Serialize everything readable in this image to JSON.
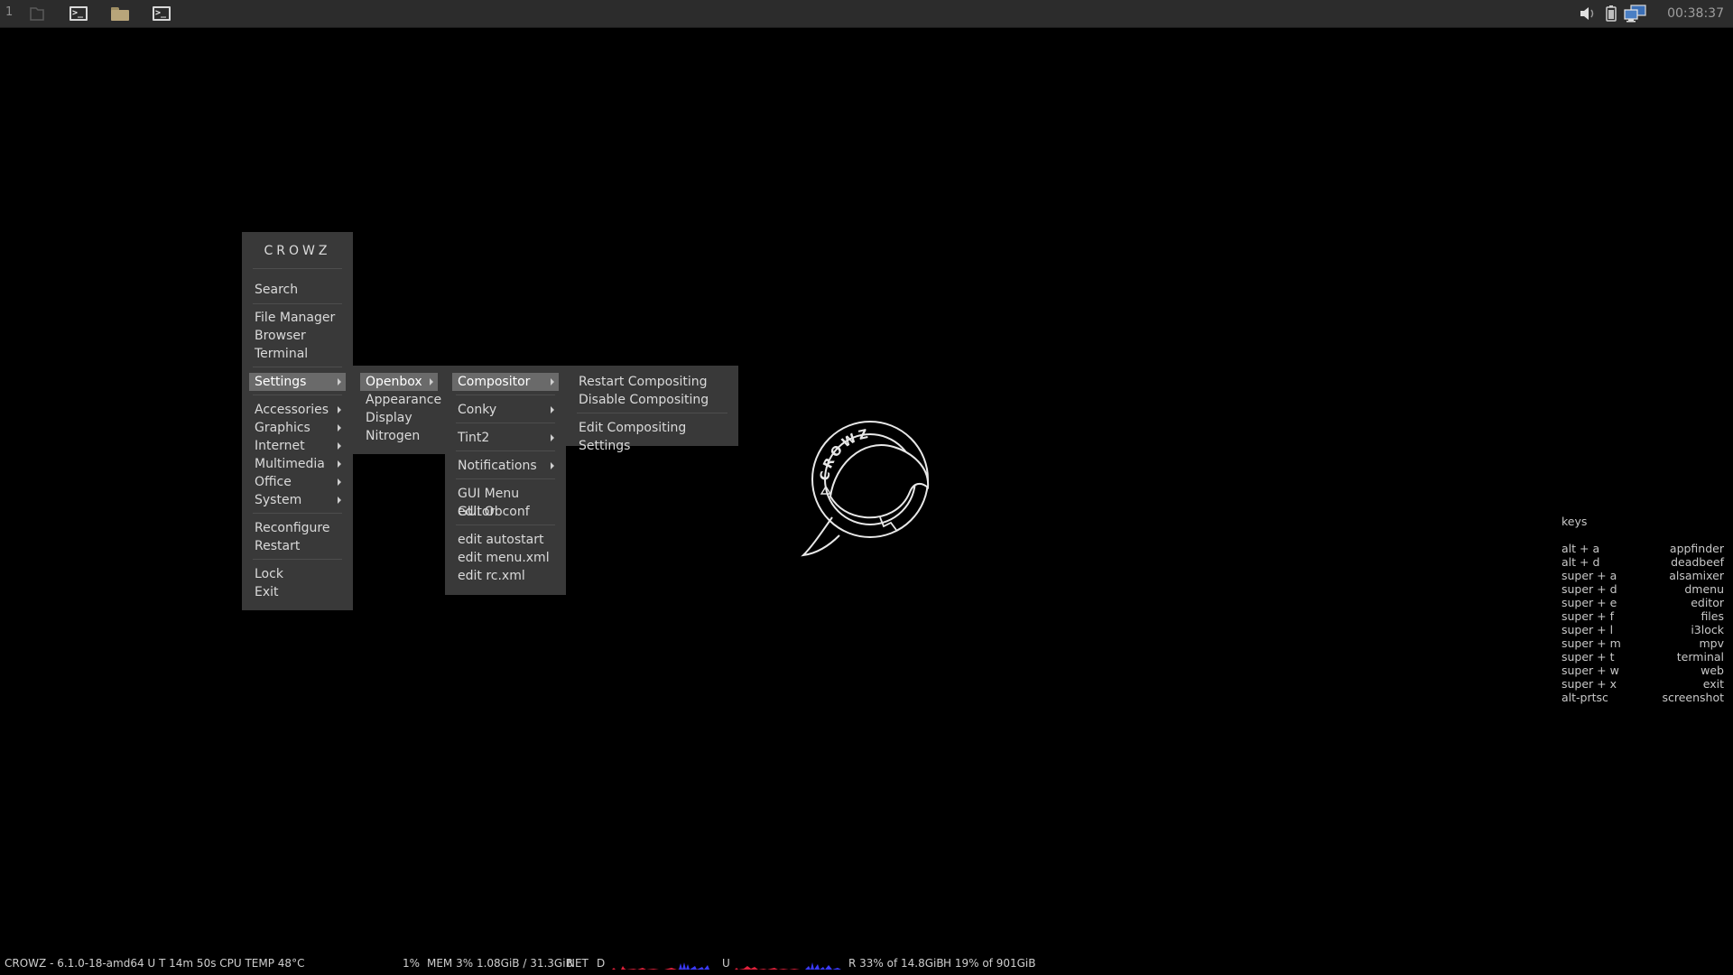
{
  "taskbar": {
    "workspace": "1",
    "clock": "00:38:37",
    "tasks": [
      {
        "icon": "document-icon",
        "active": false
      },
      {
        "icon": "terminal-icon",
        "active": true
      },
      {
        "icon": "folder-icon",
        "active": false
      },
      {
        "icon": "terminal-icon",
        "active": true
      }
    ],
    "tray": [
      "volume-icon",
      "battery-icon",
      "network-icon"
    ],
    "terminal_glyph": ">_"
  },
  "root_menu": {
    "title": "CROWZ",
    "items": [
      {
        "label": "Search"
      },
      {
        "label": "File Manager"
      },
      {
        "label": "Browser"
      },
      {
        "label": "Terminal"
      },
      {
        "label": "Settings"
      },
      {
        "label": "Accessories"
      },
      {
        "label": "Graphics"
      },
      {
        "label": "Internet"
      },
      {
        "label": "Multimedia"
      },
      {
        "label": "Office"
      },
      {
        "label": "System"
      },
      {
        "label": "Reconfigure"
      },
      {
        "label": "Restart"
      },
      {
        "label": "Lock"
      },
      {
        "label": "Exit"
      }
    ]
  },
  "settings_menu": {
    "items": [
      {
        "label": "Openbox"
      },
      {
        "label": "Appearance"
      },
      {
        "label": "Display"
      },
      {
        "label": "Nitrogen"
      }
    ]
  },
  "openbox_menu": {
    "items": [
      {
        "label": "Compositor"
      },
      {
        "label": "Conky"
      },
      {
        "label": "Tint2"
      },
      {
        "label": "Notifications"
      },
      {
        "label": "GUI Menu editor"
      },
      {
        "label": "GUI Obconf"
      },
      {
        "label": "edit autostart"
      },
      {
        "label": "edit menu.xml"
      },
      {
        "label": "edit rc.xml"
      }
    ]
  },
  "compositor_menu": {
    "items": [
      {
        "label": "Restart Compositing"
      },
      {
        "label": "Disable Compositing"
      },
      {
        "label": "Edit Compositing Settings"
      }
    ]
  },
  "logo": {
    "text": "CROWZ",
    "icon": "crow-logo-icon"
  },
  "keys": {
    "title": "keys",
    "rows": [
      {
        "key": "alt + a",
        "action": "appfinder"
      },
      {
        "key": "alt + d",
        "action": "deadbeef"
      },
      {
        "key": "super + a",
        "action": "alsamixer"
      },
      {
        "key": "super + d",
        "action": "dmenu"
      },
      {
        "key": "super + e",
        "action": "editor"
      },
      {
        "key": "super + f",
        "action": "files"
      },
      {
        "key": "super + l",
        "action": "i3lock"
      },
      {
        "key": "super + m",
        "action": "mpv"
      },
      {
        "key": "super + t",
        "action": "terminal"
      },
      {
        "key": "super + w",
        "action": "web"
      },
      {
        "key": "super + x",
        "action": "exit"
      },
      {
        "key": "alt-prtsc",
        "action": "screenshot"
      }
    ]
  },
  "status": {
    "system": "CROWZ - 6.1.0-18-amd64  U T 14m 50s CPU TEMP 48°C",
    "cpu": "1%",
    "mem": "MEM 3% 1.08GiB / 31.3GiB",
    "net_label": "NET",
    "down_label": "D",
    "up_label": "U",
    "ram": "R 33% of 14.8GiB",
    "disk": "H  19% of 901GiB"
  },
  "colors": {
    "background": "#000000",
    "menu_bg": "#393939",
    "menu_highlight": "#6a6a6a",
    "taskbar_bg": "#2c2c2c",
    "folder": "#b8a57a",
    "graph_down": "#e0203a",
    "graph_up": "#3a3aff"
  }
}
